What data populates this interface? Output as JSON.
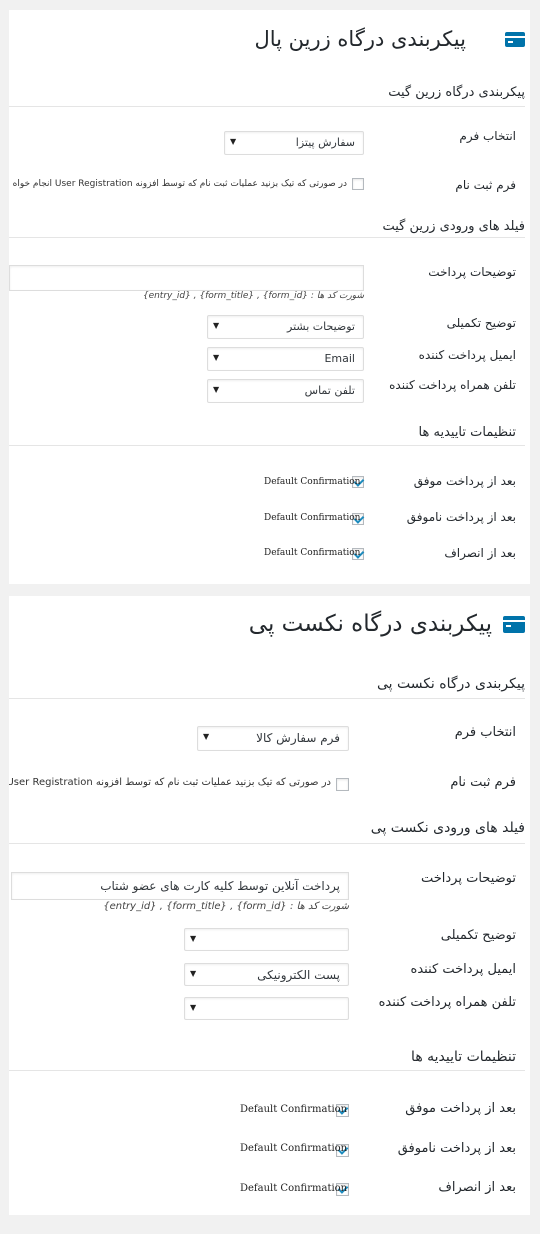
{
  "zarinpal": {
    "title": "پیکربندی درگاه زرین پال",
    "icon": "credit-card-icon",
    "section_gateway": "پیکربندی درگاه زرین گیت",
    "form_select_label": "انتخاب فرم",
    "form_select_value": "سفارش پیتزا",
    "register_form_label": "فرم ثبت نام",
    "register_form_desc": "در صورتی که تیک بزنید عملیات ثبت نام که توسط افزونه User Registration انجام خواه",
    "section_fields": "فیلد های ورودی زرین گیت",
    "payment_desc_label": "توضیحات پرداخت",
    "payment_desc_value": "",
    "shortcodes_hint": "شورت کد ها : {form_id} , {form_title} , {entry_id}",
    "extra_desc_label": "توضیح تکمیلی",
    "extra_desc_value": "توضیحات بشتر",
    "payer_email_label": "ایمیل پرداخت کننده",
    "payer_email_value": "Email",
    "payer_phone_label": "تلفن همراه پرداخت کننده",
    "payer_phone_value": "تلفن تماس",
    "section_confirm": "تنظیمات تاییدیه ها",
    "confirm_success_label": "بعد از پرداخت موفق",
    "confirm_failed_label": "بعد از پرداخت ناموفق",
    "confirm_cancel_label": "بعد از انصراف",
    "confirmation_value": "Default Confirmation"
  },
  "nextpay": {
    "title": "پیکربندی درگاه نکست پی",
    "icon": "credit-card-icon",
    "section_gateway": "پیکربندی درگاه نکست پی",
    "form_select_label": "انتخاب فرم",
    "form_select_value": "فرم سفارش کالا",
    "register_form_label": "فرم ثبت نام",
    "register_form_desc": "در صورتی که تیک بزنید عملیات ثبت نام که توسط افزونه User Registration",
    "section_fields": "فیلد های ورودی نکست پی",
    "payment_desc_label": "توضیحات پرداخت",
    "payment_desc_value": "پرداخت آنلاین توسط کلیه کارت های عضو شتاب",
    "shortcodes_hint": "شورت کد ها : {form_id} , {form_title} , {entry_id}",
    "extra_desc_label": "توضیح تکمیلی",
    "extra_desc_value": "",
    "payer_email_label": "ایمیل پرداخت کننده",
    "payer_email_value": "پست الکترونیکی",
    "payer_phone_label": "تلفن همراه پرداخت کننده",
    "payer_phone_value": "",
    "section_confirm": "تنظیمات تاییدیه ها",
    "confirm_success_label": "بعد از پرداخت موفق",
    "confirm_failed_label": "بعد از پرداخت ناموفق",
    "confirm_cancel_label": "بعد از انصراف",
    "confirmation_value": "Default Confirmation"
  },
  "colors": {
    "accent": "#0073aa",
    "check": "#1e8cbe",
    "background": "#f1f1f1"
  }
}
